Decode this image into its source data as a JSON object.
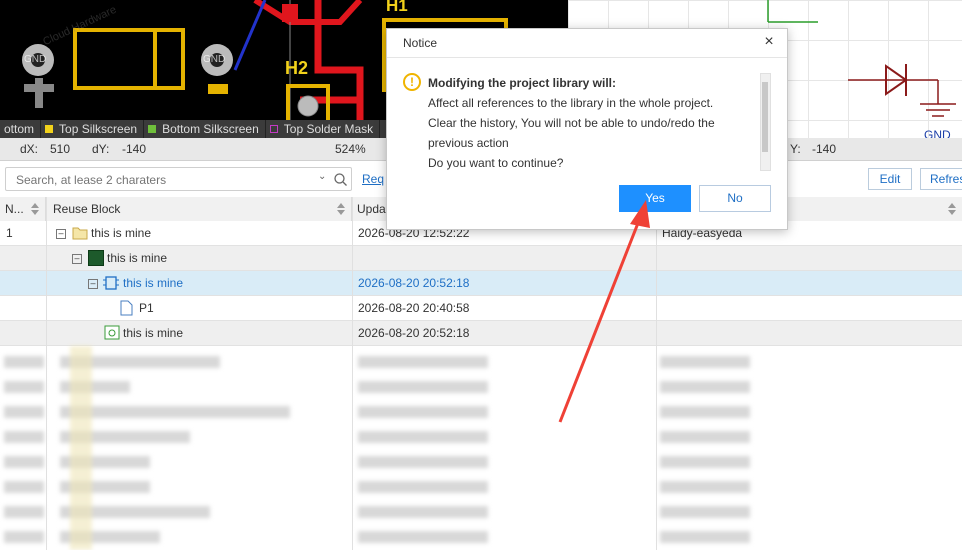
{
  "pcb": {
    "designators": [
      "H1",
      "H2"
    ],
    "net_labels": [
      "GND",
      "GND"
    ],
    "watermark": "Cloud Hardware"
  },
  "layers": [
    {
      "label": "ottom",
      "color": ""
    },
    {
      "label": "Top Silkscreen",
      "color": "#f2d21b"
    },
    {
      "label": "Bottom Silkscreen",
      "color": "#6fbf3b"
    },
    {
      "label": "Top Solder Mask",
      "color": "#c33bc3"
    }
  ],
  "coords": {
    "dx_label": "dX:",
    "dx_value": "510",
    "dy_label": "dY:",
    "dy_value": "-140",
    "zoom": "524%",
    "dy2_label": "Y:",
    "dy2_value": "-140"
  },
  "schematic": {
    "net_label": "GND"
  },
  "toolbar": {
    "search_placeholder": "Search, at lease 2 charaters",
    "req_link": "Req",
    "edit_label": "Edit",
    "refresh_label": "Refres"
  },
  "table": {
    "headers": [
      "N...",
      "Reuse Block",
      "Upda",
      ""
    ],
    "rows": [
      {
        "no": "1",
        "name": "this is mine",
        "updated": "2026-08-20 12:52:22",
        "owner": "Haidy-easyeda",
        "icon": "folder-icon"
      },
      {
        "no": "",
        "name": "this is mine",
        "updated": "",
        "owner": "",
        "icon": "pcb-block-icon"
      },
      {
        "no": "",
        "name": "this is mine",
        "updated": "2026-08-20 20:52:18",
        "owner": "",
        "icon": "component-icon"
      },
      {
        "no": "",
        "name": "P1",
        "updated": "2026-08-20 20:40:58",
        "owner": "",
        "icon": "document-icon"
      },
      {
        "no": "",
        "name": "this is mine",
        "updated": "2026-08-20 20:52:18",
        "owner": "",
        "icon": "schematic-icon"
      }
    ]
  },
  "dialog": {
    "title": "Notice",
    "heading": "Modifying the project library will:",
    "lines": [
      "Affect all references to the library in the whole project.",
      "Clear the history, You will not be able to undo/redo the",
      "previous action",
      "Do you want to continue?"
    ],
    "yes_label": "Yes",
    "no_label": "No"
  },
  "colors": {
    "accent": "#1e90ff",
    "selected_row": "#d9ecf7",
    "arrow": "#ef4136"
  }
}
